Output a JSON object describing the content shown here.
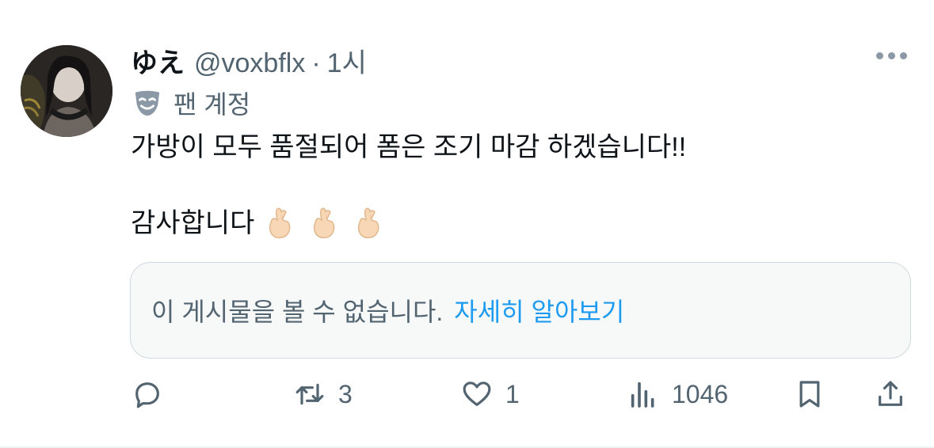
{
  "post": {
    "display_name": "ゆえ",
    "handle": "@voxbflx",
    "separator": "·",
    "time": "1시",
    "badge_label": "팬 계정",
    "text_line1": "가방이 모두 품절되어 폼은 조기 마감 하겠습니다!!",
    "text_line2": "감사합니다",
    "emoji": "🫰"
  },
  "notice": {
    "message": "이 게시물을 볼 수 없습니다.",
    "link": "자세히 알아보기"
  },
  "actions": {
    "reply_count": "",
    "repost_count": "3",
    "like_count": "1",
    "views_count": "1046"
  },
  "colors": {
    "text": "#0f1419",
    "secondary": "#536471",
    "link": "#1d9bf0",
    "card_bg": "#f7f9f9",
    "border": "#cfd9de"
  },
  "icons": [
    "reply-icon",
    "repost-icon",
    "like-icon",
    "views-icon",
    "bookmark-icon",
    "share-icon",
    "more-icon",
    "theater-mask-icon"
  ]
}
